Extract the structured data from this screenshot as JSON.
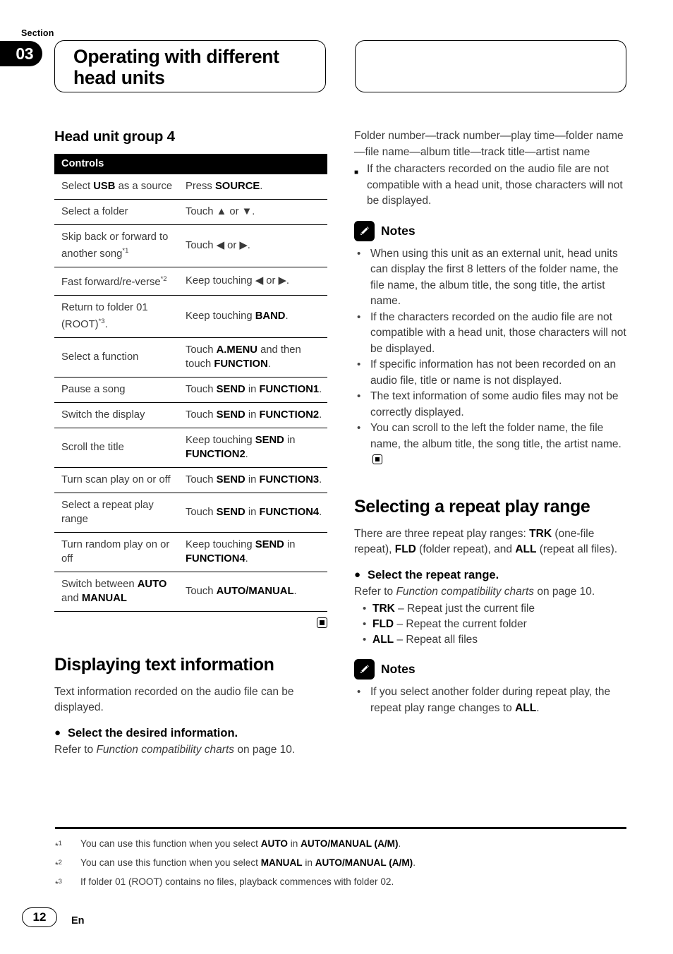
{
  "header": {
    "section_word": "Section",
    "section_number": "03",
    "title": "Operating with different head units"
  },
  "left_column": {
    "heading": "Head unit group 4",
    "table": {
      "header": "Controls",
      "rows": [
        {
          "control_prefix": "Select ",
          "control_bold": "USB",
          "control_suffix": " as a source",
          "action_plain1": "Press ",
          "action_bold": "SOURCE",
          "action_plain2": "."
        },
        {
          "control_prefix": "Select a folder",
          "control_bold": "",
          "control_suffix": "",
          "action_plain1": "Touch ▲ or ▼.",
          "action_bold": "",
          "action_plain2": ""
        },
        {
          "control_prefix": "Skip back or forward to another song",
          "control_note": "*1",
          "control_suffix": "",
          "action_plain1": "Touch ◀ or ▶.",
          "action_bold": "",
          "action_plain2": ""
        },
        {
          "control_prefix": "Fast forward/re-verse",
          "control_note": "*2",
          "control_suffix": "",
          "action_plain1": "Keep touching ◀ or ▶.",
          "action_bold": "",
          "action_plain2": ""
        },
        {
          "control_prefix": "Return to folder 01 (ROOT)",
          "control_note": "*3",
          "control_suffix": ".",
          "action_plain1": "Keep touching ",
          "action_bold": "BAND",
          "action_plain2": "."
        },
        {
          "control_prefix": "Select a function",
          "control_bold": "",
          "control_suffix": "",
          "action_plain1": "Touch ",
          "action_bold": "A.MENU",
          "action_mid": " and then touch ",
          "action_bold2": "FUNCTION",
          "action_plain2": "."
        },
        {
          "control_prefix": "Pause a song",
          "control_bold": "",
          "control_suffix": "",
          "action_plain1": "Touch ",
          "action_bold": "SEND",
          "action_mid": " in ",
          "action_bold2": "FUNCTION1",
          "action_plain2": "."
        },
        {
          "control_prefix": "Switch the display",
          "control_bold": "",
          "control_suffix": "",
          "action_plain1": "Touch ",
          "action_bold": "SEND",
          "action_mid": " in ",
          "action_bold2": "FUNCTION2",
          "action_plain2": "."
        },
        {
          "control_prefix": "Scroll the title",
          "control_bold": "",
          "control_suffix": "",
          "action_plain1": "Keep touching ",
          "action_bold": "SEND",
          "action_mid": " in ",
          "action_bold2": "FUNCTION2",
          "action_plain2": "."
        },
        {
          "control_prefix": "Turn scan play on or off",
          "control_bold": "",
          "control_suffix": "",
          "action_plain1": "Touch ",
          "action_bold": "SEND",
          "action_mid": " in ",
          "action_bold2": "FUNCTION3",
          "action_plain2": "."
        },
        {
          "control_prefix": "Select a repeat play range",
          "control_bold": "",
          "control_suffix": "",
          "action_plain1": "Touch ",
          "action_bold": "SEND",
          "action_mid": " in ",
          "action_bold2": "FUNCTION4",
          "action_plain2": "."
        },
        {
          "control_prefix": "Turn random play on or off",
          "control_bold": "",
          "control_suffix": "",
          "action_plain1": "Keep touching ",
          "action_bold": "SEND",
          "action_mid": " in ",
          "action_bold2": "FUNCTION4",
          "action_plain2": "."
        },
        {
          "control_prefix": "Switch between ",
          "control_bold": "AUTO",
          "control_mid": " and ",
          "control_bold2": "MANUAL",
          "control_suffix": "",
          "action_plain1": "Touch ",
          "action_bold": "AUTO/MANUAL",
          "action_plain2": "."
        }
      ]
    },
    "section2": {
      "heading": "Displaying text information",
      "intro": "Text information recorded on the audio file can be displayed.",
      "action_bullet": "●",
      "action": "Select the desired information.",
      "refer_prefix": "Refer to ",
      "refer_italic": "Function compatibility charts",
      "refer_suffix": " on page 10."
    }
  },
  "right_column": {
    "intro_line": "Folder number—track number—play time—folder name—file name—album title—track title—artist name",
    "square_bullet": "■",
    "square_note": "If the characters recorded on the audio file are not compatible with a head unit, those characters will not be displayed.",
    "notes_label_1": "Notes",
    "notes_1": [
      "When using this unit as an external unit, head units can display the first 8 letters of the folder name, the file name, the album title, the song title, the artist name.",
      "If the characters recorded on the audio file are not compatible with a head unit, those characters will not be displayed.",
      "If specific information has not been recorded on an audio file, title or name is not displayed.",
      "The text information of some audio files may not be correctly displayed.",
      "You can scroll to the left the folder name, the file name, the album title, the song title, the artist name."
    ],
    "section": {
      "heading": "Selecting a repeat play range",
      "intro_p1": "There are three repeat play ranges: ",
      "intro_b1": "TRK",
      "intro_p2": " (one-file repeat), ",
      "intro_b2": "FLD",
      "intro_p3": " (folder repeat), and ",
      "intro_b3": "ALL",
      "intro_p4": " (repeat all files).",
      "action_bullet": "●",
      "action": "Select the repeat range.",
      "refer_prefix": "Refer to ",
      "refer_italic": "Function compatibility charts",
      "refer_suffix": " on page 10.",
      "ranges": [
        {
          "code": "TRK",
          "desc": " – Repeat just the current file"
        },
        {
          "code": "FLD",
          "desc": " – Repeat the current folder"
        },
        {
          "code": "ALL",
          "desc": " – Repeat all files"
        }
      ]
    },
    "notes_label_2": "Notes",
    "notes_2_prefix": "If you select another folder during repeat play, the repeat play range changes to ",
    "notes_2_bold": "ALL",
    "notes_2_suffix": "."
  },
  "footnotes": [
    {
      "mark": "*",
      "sup": "1",
      "p1": "You can use this function when you select ",
      "b1": "AUTO",
      "p2": " in ",
      "b2": "AUTO/MANUAL (A/M)",
      "p3": "."
    },
    {
      "mark": "*",
      "sup": "2",
      "p1": "You can use this function when you select ",
      "b1": "MANUAL",
      "p2": " in ",
      "b2": "AUTO/MANUAL (A/M)",
      "p3": "."
    },
    {
      "mark": "*",
      "sup": "3",
      "p1": "If folder 01 (ROOT) contains no files, playback commences with folder 02.",
      "b1": "",
      "p2": "",
      "b2": "",
      "p3": ""
    }
  ],
  "footer": {
    "page_number": "12",
    "language": "En"
  },
  "colors": {
    "ink": "#000000",
    "body_text": "#3a3a3a",
    "page_bg": "#ffffff"
  }
}
